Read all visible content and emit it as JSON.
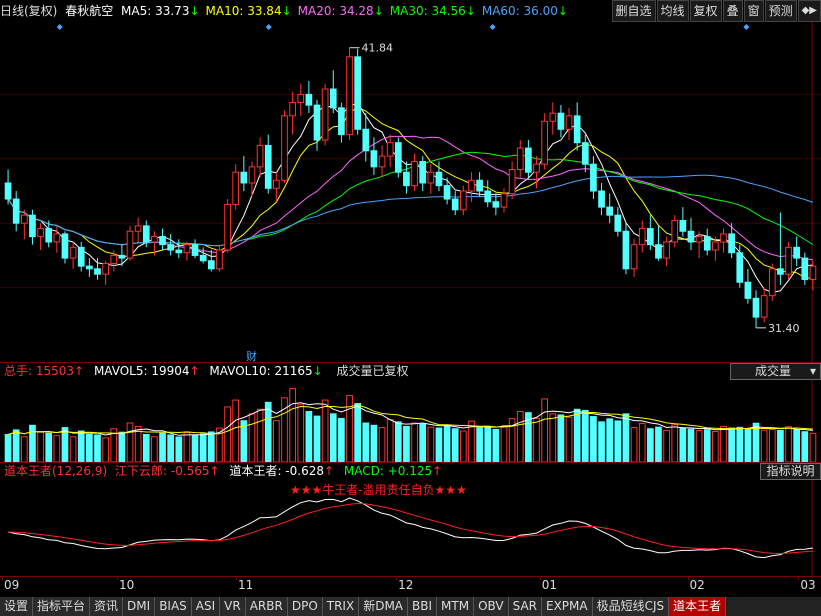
{
  "header": {
    "period": "日线(复权)",
    "stock_name": "春秋航空",
    "ma": [
      {
        "label": "MA5: 33.73",
        "arrow": "↓",
        "color": "#ffffff"
      },
      {
        "label": "MA10: 33.84",
        "arrow": "↓",
        "color": "#ffff00"
      },
      {
        "label": "MA20: 34.28",
        "arrow": "↓",
        "color": "#ff66ff"
      },
      {
        "label": "MA30: 34.56",
        "arrow": "↓",
        "color": "#00ff00"
      },
      {
        "label": "MA60: 36.00",
        "arrow": "↓",
        "color": "#4aa3ff"
      }
    ],
    "buttons": [
      "删自选",
      "均线",
      "复权",
      "叠",
      "窗",
      "预测"
    ]
  },
  "price_panel": {
    "high_label": "41.84",
    "low_label": "31.40",
    "event_marker": "财",
    "ylim": [
      30.5,
      42.5
    ]
  },
  "volume_panel": {
    "total_label": "总手: 15503",
    "mavol5": "MAVOL5: 19904",
    "mavol10": "MAVOL10: 21165",
    "note": "成交量已复权",
    "selector": "成交量"
  },
  "macd_panel": {
    "indicator": "道本王者(12,26,9)",
    "line1": "江下云郎: -0.565",
    "line2": "道本王者: -0.628",
    "line3": "MACD: +0.125",
    "button": "指标说明",
    "banner": "★★★牛王者-滥用责任自负★★★"
  },
  "x_axis": [
    "09",
    "10",
    "11",
    "12",
    "01",
    "02",
    "03"
  ],
  "bottom_tabs": [
    "设置",
    "指标平台",
    "资讯",
    "DMI",
    "BIAS",
    "ASI",
    "VR",
    "ARBR",
    "DPO",
    "TRIX",
    "新DMA",
    "BBI",
    "MTM",
    "OBV",
    "SAR",
    "EXPMA",
    "极品短线CJS",
    "道本王者"
  ],
  "colors": {
    "up": "#ff3232",
    "down": "#54ffff",
    "grid": "#7a0000",
    "bg": "#000000"
  },
  "chart_data": {
    "type": "candlestick",
    "ohlc": [
      [
        36.8,
        37.3,
        36.0,
        36.2
      ],
      [
        36.2,
        36.5,
        35.0,
        35.3
      ],
      [
        35.3,
        35.8,
        34.7,
        35.6
      ],
      [
        35.6,
        35.8,
        34.5,
        34.8
      ],
      [
        34.8,
        35.3,
        34.3,
        35.1
      ],
      [
        35.1,
        35.4,
        34.4,
        34.6
      ],
      [
        34.6,
        35.2,
        34.2,
        34.9
      ],
      [
        34.9,
        35.0,
        33.8,
        34.0
      ],
      [
        34.0,
        34.6,
        33.6,
        34.4
      ],
      [
        34.4,
        34.6,
        33.5,
        33.7
      ],
      [
        33.7,
        34.0,
        33.3,
        33.6
      ],
      [
        33.6,
        34.0,
        33.2,
        33.4
      ],
      [
        33.4,
        33.9,
        33.0,
        33.8
      ],
      [
        33.8,
        34.3,
        33.5,
        34.1
      ],
      [
        34.1,
        34.5,
        33.7,
        34.0
      ],
      [
        34.0,
        35.2,
        33.9,
        35.0
      ],
      [
        35.0,
        35.5,
        34.6,
        35.2
      ],
      [
        35.2,
        35.4,
        34.4,
        34.6
      ],
      [
        34.6,
        35.0,
        34.1,
        34.8
      ],
      [
        34.8,
        35.1,
        34.3,
        34.5
      ],
      [
        34.5,
        34.9,
        34.1,
        34.3
      ],
      [
        34.3,
        34.7,
        34.0,
        34.2
      ],
      [
        34.2,
        34.6,
        33.9,
        34.5
      ],
      [
        34.5,
        34.7,
        34.0,
        34.1
      ],
      [
        34.1,
        34.4,
        33.8,
        33.9
      ],
      [
        33.9,
        34.3,
        33.5,
        33.6
      ],
      [
        33.6,
        34.5,
        33.5,
        34.3
      ],
      [
        34.3,
        36.2,
        34.2,
        36.0
      ],
      [
        36.0,
        37.5,
        35.8,
        37.2
      ],
      [
        37.2,
        37.8,
        36.5,
        36.8
      ],
      [
        36.8,
        37.6,
        36.3,
        37.4
      ],
      [
        37.4,
        38.5,
        37.0,
        38.2
      ],
      [
        38.2,
        38.6,
        36.4,
        36.6
      ],
      [
        36.6,
        37.2,
        36.1,
        36.9
      ],
      [
        36.9,
        39.5,
        36.8,
        39.3
      ],
      [
        39.3,
        40.2,
        38.6,
        39.8
      ],
      [
        39.8,
        40.5,
        39.3,
        40.1
      ],
      [
        40.1,
        40.6,
        39.4,
        39.7
      ],
      [
        39.7,
        39.9,
        38.0,
        38.4
      ],
      [
        38.4,
        40.5,
        38.2,
        40.3
      ],
      [
        40.3,
        41.0,
        39.4,
        39.6
      ],
      [
        39.6,
        39.8,
        38.3,
        38.6
      ],
      [
        38.6,
        41.84,
        38.4,
        41.5
      ],
      [
        41.5,
        41.8,
        38.6,
        38.8
      ],
      [
        38.8,
        39.4,
        37.6,
        38.0
      ],
      [
        38.0,
        38.5,
        37.1,
        37.4
      ],
      [
        37.4,
        38.2,
        37.0,
        37.8
      ],
      [
        37.8,
        38.6,
        37.4,
        38.3
      ],
      [
        38.3,
        38.5,
        37.0,
        37.2
      ],
      [
        37.2,
        37.6,
        36.4,
        36.7
      ],
      [
        36.7,
        37.9,
        36.5,
        37.6
      ],
      [
        37.6,
        37.8,
        36.5,
        36.8
      ],
      [
        36.8,
        37.5,
        36.4,
        37.2
      ],
      [
        37.2,
        37.6,
        36.5,
        36.7
      ],
      [
        36.7,
        37.0,
        36.0,
        36.2
      ],
      [
        36.2,
        36.5,
        35.6,
        35.8
      ],
      [
        35.8,
        36.7,
        35.6,
        36.5
      ],
      [
        36.5,
        37.2,
        36.1,
        36.9
      ],
      [
        36.9,
        37.2,
        36.3,
        36.5
      ],
      [
        36.5,
        36.9,
        35.9,
        36.1
      ],
      [
        36.1,
        36.4,
        35.6,
        35.9
      ],
      [
        35.9,
        36.6,
        35.7,
        36.4
      ],
      [
        36.4,
        37.6,
        36.2,
        37.3
      ],
      [
        37.3,
        38.4,
        37.0,
        38.1
      ],
      [
        38.1,
        38.4,
        37.0,
        37.2
      ],
      [
        37.2,
        37.8,
        36.6,
        37.5
      ],
      [
        37.5,
        39.4,
        37.3,
        39.1
      ],
      [
        39.1,
        39.8,
        38.6,
        39.4
      ],
      [
        39.4,
        39.7,
        38.5,
        38.8
      ],
      [
        38.8,
        39.6,
        38.4,
        39.3
      ],
      [
        39.3,
        39.8,
        38.0,
        38.3
      ],
      [
        38.3,
        38.6,
        37.2,
        37.5
      ],
      [
        37.5,
        37.8,
        36.2,
        36.5
      ],
      [
        36.5,
        36.8,
        35.6,
        35.9
      ],
      [
        35.9,
        36.4,
        35.3,
        35.6
      ],
      [
        35.6,
        35.9,
        34.8,
        35.0
      ],
      [
        35.0,
        35.3,
        33.4,
        33.6
      ],
      [
        33.6,
        34.7,
        33.3,
        34.5
      ],
      [
        34.5,
        35.4,
        34.2,
        35.1
      ],
      [
        35.1,
        35.6,
        34.3,
        34.5
      ],
      [
        34.5,
        35.2,
        33.9,
        34.0
      ],
      [
        34.0,
        34.8,
        33.7,
        34.6
      ],
      [
        34.6,
        35.6,
        34.4,
        35.4
      ],
      [
        35.4,
        35.9,
        34.8,
        35.0
      ],
      [
        35.0,
        35.5,
        34.3,
        34.6
      ],
      [
        34.6,
        35.0,
        34.0,
        34.8
      ],
      [
        34.8,
        35.1,
        34.1,
        34.3
      ],
      [
        34.3,
        34.8,
        33.9,
        34.6
      ],
      [
        34.6,
        35.1,
        34.2,
        34.9
      ],
      [
        34.9,
        35.3,
        34.0,
        34.2
      ],
      [
        34.2,
        34.5,
        32.9,
        33.1
      ],
      [
        33.1,
        33.6,
        32.3,
        32.5
      ],
      [
        32.5,
        32.8,
        31.4,
        31.8
      ],
      [
        31.8,
        32.9,
        31.6,
        32.6
      ],
      [
        32.6,
        33.8,
        32.4,
        33.6
      ],
      [
        33.6,
        35.7,
        33.0,
        33.4
      ],
      [
        33.4,
        34.6,
        33.2,
        34.4
      ],
      [
        34.4,
        34.8,
        33.7,
        34.0
      ],
      [
        34.0,
        34.2,
        33.0,
        33.2
      ],
      [
        33.2,
        33.9,
        32.8,
        33.7
      ]
    ],
    "volume": [
      12000,
      14000,
      11000,
      16000,
      13000,
      12500,
      11500,
      15000,
      11000,
      13500,
      12000,
      11800,
      10500,
      14500,
      13000,
      17000,
      15500,
      12000,
      11000,
      12500,
      11800,
      10900,
      12800,
      11500,
      12200,
      13100,
      14800,
      24000,
      27000,
      18000,
      21000,
      23000,
      26000,
      18000,
      28000,
      32000,
      25000,
      22000,
      20000,
      27000,
      21000,
      19000,
      29000,
      25500,
      17000,
      16000,
      15000,
      18500,
      17500,
      15500,
      17000,
      16500,
      15200,
      14800,
      16100,
      14500,
      13500,
      17800,
      14900,
      15600,
      14200,
      15800,
      18900,
      22000,
      21500,
      19000,
      27500,
      21000,
      20500,
      19500,
      23000,
      22500,
      19800,
      17500,
      18800,
      17900,
      21000,
      15000,
      16800,
      14500,
      15200,
      13800,
      16200,
      14900,
      14300,
      13700,
      14100,
      13300,
      15500,
      14800,
      15100,
      14600,
      16900,
      13900,
      14200,
      13800,
      15400,
      14000,
      13200,
      12500
    ]
  }
}
